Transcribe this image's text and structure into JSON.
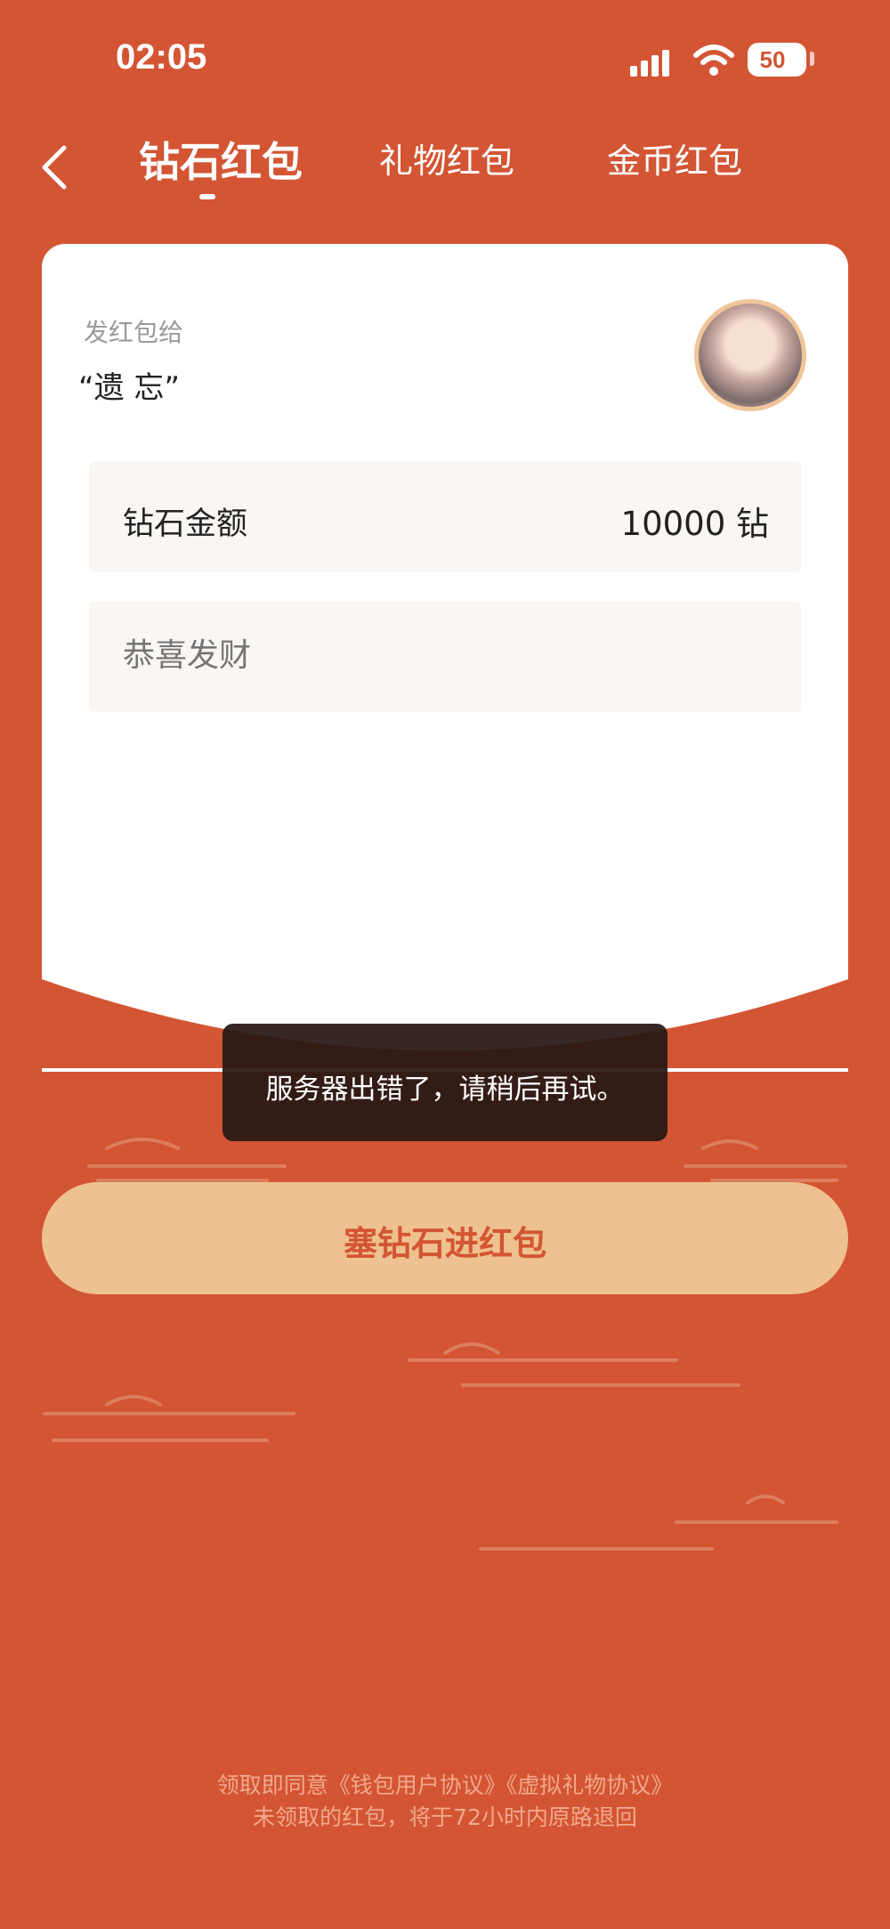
{
  "status_bar": {
    "time": "02:05",
    "battery": "50"
  },
  "nav": {
    "back_icon": "chevron-left-icon",
    "tabs": [
      {
        "label": "钻石红包",
        "active": true
      },
      {
        "label": "礼物红包",
        "active": false
      },
      {
        "label": "金币红包",
        "active": false
      }
    ]
  },
  "card": {
    "send_to_label": "发红包给",
    "recipient": "“遗 忘”",
    "amount_label": "钻石金额",
    "amount_value": "10000 钻",
    "greeting_placeholder": "恭喜发财"
  },
  "toast": {
    "message": "服务器出错了，请稍后再试。"
  },
  "send_button": {
    "label": "塞钻石进红包"
  },
  "footer": {
    "line1": "领取即同意《钱包用户协议》《虚拟礼物协议》",
    "line2": "未领取的红包，将于72小时内原路退回"
  },
  "colors": {
    "background": "#d35533",
    "button": "#eec190",
    "accent_text": "#d35533"
  }
}
